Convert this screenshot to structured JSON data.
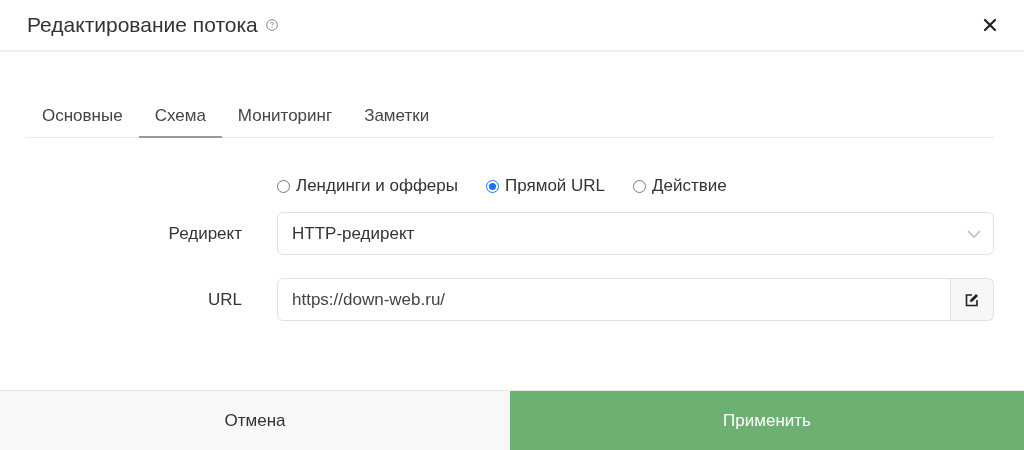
{
  "window": {
    "title": "Редактирование потока"
  },
  "tabs": [
    {
      "label": "Основные",
      "selected": false
    },
    {
      "label": "Схема",
      "selected": true
    },
    {
      "label": "Мониторинг",
      "selected": false
    },
    {
      "label": "Заметки",
      "selected": false
    }
  ],
  "scheme": [
    {
      "label": "Лендинги и офферы",
      "selected": false
    },
    {
      "label": "Прямой URL",
      "selected": true
    },
    {
      "label": "Действие",
      "selected": false
    }
  ],
  "redirect": {
    "label": "Редирект",
    "value": "HTTP-редирект"
  },
  "url": {
    "label": "URL",
    "value": "https://down-web.ru/"
  },
  "buttons": [
    {
      "label": "Отмена",
      "kind": "cancel"
    },
    {
      "label": "Применить",
      "kind": "apply"
    }
  ]
}
